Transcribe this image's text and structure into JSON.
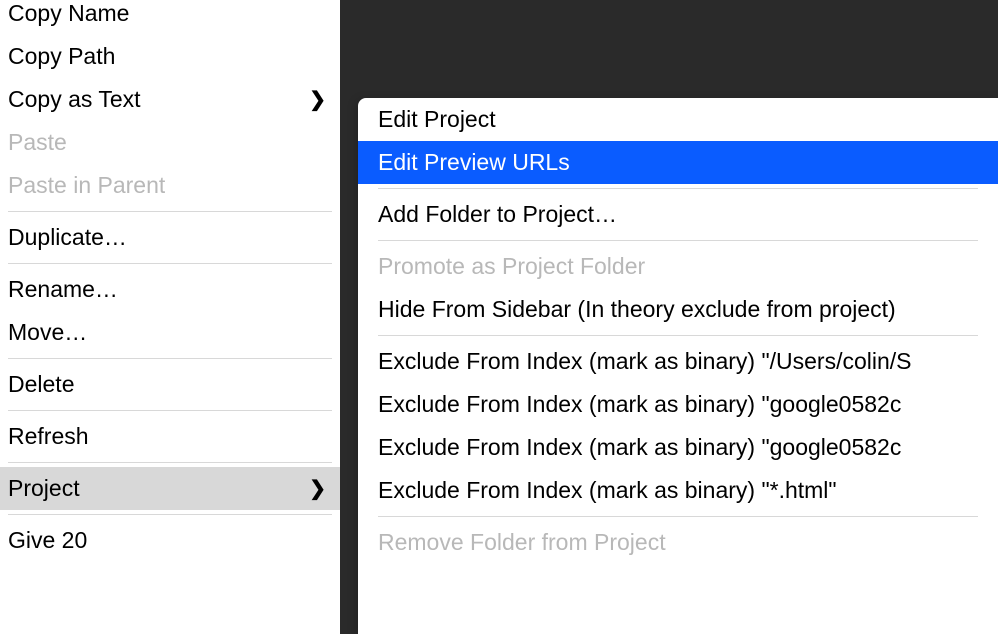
{
  "mainMenu": {
    "copyName": "Copy Name",
    "copyPath": "Copy Path",
    "copyAsText": "Copy as Text",
    "paste": "Paste",
    "pasteInParent": "Paste in Parent",
    "duplicate": "Duplicate…",
    "rename": "Rename…",
    "move": "Move…",
    "delete": "Delete",
    "refresh": "Refresh",
    "project": "Project",
    "give20": "Give 20"
  },
  "subMenu": {
    "editProject": "Edit Project",
    "editPreviewURLs": "Edit Preview URLs",
    "addFolderToProject": "Add Folder to Project…",
    "promoteAsProjectFolder": "Promote as Project Folder",
    "hideFromSidebar": "Hide From Sidebar (In theory exclude from project)",
    "excludeFromIndex1": "Exclude From Index (mark as binary) \"/Users/colin/S",
    "excludeFromIndex2": "Exclude From Index (mark as binary) \"google0582c",
    "excludeFromIndex3": "Exclude From Index (mark as binary) \"google0582c",
    "excludeFromIndex4": "Exclude From Index (mark as binary) \"*.html\"",
    "removeFolderFromProject": "Remove Folder from Project"
  }
}
